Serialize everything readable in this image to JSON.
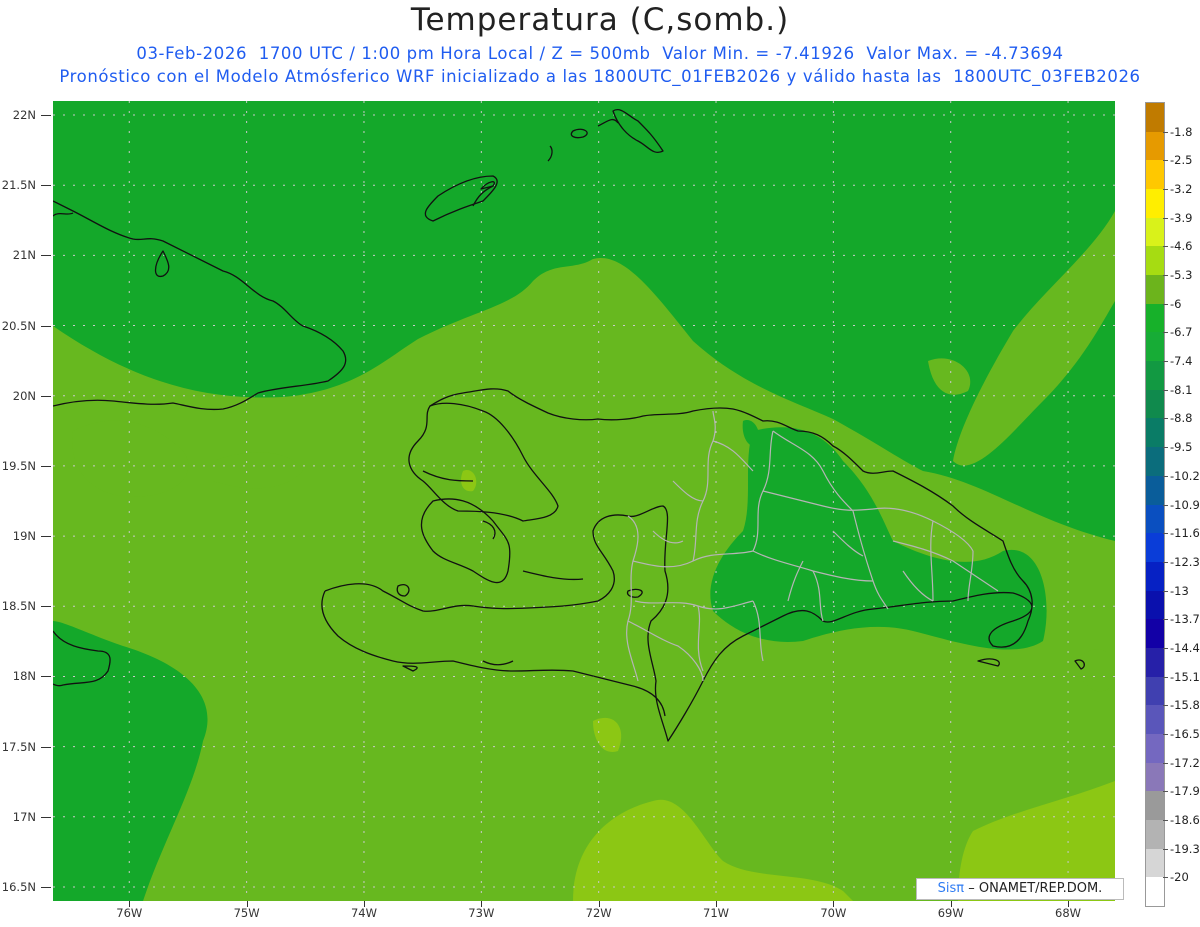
{
  "title": "Temperatura (C,somb.)",
  "subtitle_line1": "03-Feb-2026  1700 UTC / 1:00 pm Hora Local / Z = 500mb  Valor Min. = -7.41926  Valor Max. = -4.73694",
  "subtitle_line2": "Pronóstico con el Modelo Atmósferico WRF inicializado a las 1800UTC_01FEB2026 y válido hasta las  1800UTC_03FEB2026",
  "map": {
    "lat_labels": [
      "22N",
      "21.5N",
      "21N",
      "20.5N",
      "20N",
      "19.5N",
      "19N",
      "18.5N",
      "18N",
      "17.5N",
      "17N",
      "16.5N"
    ],
    "lat_values": [
      22,
      21.5,
      21,
      20.5,
      20,
      19.5,
      19,
      18.5,
      18,
      17.5,
      17,
      16.5
    ],
    "lon_labels": [
      "76W",
      "75W",
      "74W",
      "73W",
      "72W",
      "71W",
      "70W",
      "69W",
      "68W"
    ],
    "lon_values": [
      -76,
      -75,
      -74,
      -73,
      -72,
      -71,
      -70,
      -69,
      -68
    ],
    "lat_range": [
      16.4,
      22.1
    ],
    "lon_range": [
      -76.65,
      -67.6
    ],
    "grid": "dotted",
    "colors": {
      "background": "#14a82a",
      "shade_light": "#67b81f",
      "shade_lighter": "#8cc714",
      "coastline": "#111111",
      "provinces": "#b0b0b0"
    }
  },
  "colorbar": {
    "labels": [
      "-1.8",
      "-2.5",
      "-3.2",
      "-3.9",
      "-4.6",
      "-5.3",
      "-6",
      "-6.7",
      "-7.4",
      "-8.1",
      "-8.8",
      "-9.5",
      "-10.2",
      "-10.9",
      "-11.6",
      "-12.3",
      "-13",
      "-13.7",
      "-14.4",
      "-15.1",
      "-15.8",
      "-16.5",
      "-17.2",
      "-17.9",
      "-18.6",
      "-19.3",
      "-20"
    ],
    "colors": [
      "#c07b00",
      "#e69a00",
      "#ffc800",
      "#ffee00",
      "#d9f21a",
      "#a6dc12",
      "#6cb41c",
      "#17b12a",
      "#17ac36",
      "#129942",
      "#108a4d",
      "#0a7c66",
      "#0b6d7c",
      "#0a5d9a",
      "#0a4fc0",
      "#0a3dd8",
      "#0621c4",
      "#0a10ad",
      "#1200a6",
      "#2620a8",
      "#4040b0",
      "#5a56ba",
      "#7468c0",
      "#8a78b8",
      "#9a9a9a",
      "#b3b3b3",
      "#d6d6d6",
      "#ffffff"
    ]
  },
  "credit": {
    "logo": "Sisπ",
    "text": "– ONAMET/REP.DOM."
  }
}
